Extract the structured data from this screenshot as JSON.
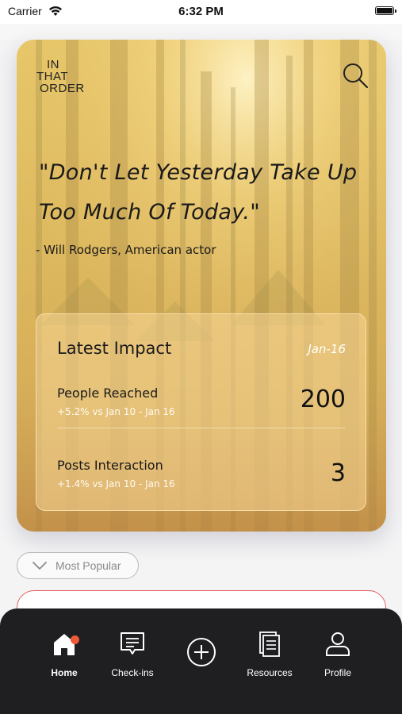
{
  "status_bar": {
    "carrier": "Carrier",
    "time": "6:32 PM"
  },
  "hero": {
    "logo": {
      "line1": "IN",
      "line2": "THAT",
      "line3": "ORDER"
    },
    "quote": "\"Don't Let Yesterday Take Up Too Much Of Today.\"",
    "author": "- Will Rodgers, American actor",
    "search_icon": "search-icon"
  },
  "impact": {
    "title": "Latest Impact",
    "date": "Jan-16",
    "metrics": [
      {
        "label": "People Reached",
        "change": "+5.2% vs Jan 10 - Jan 16",
        "value": "200"
      },
      {
        "label": "Posts Interaction",
        "change": "+1.4% vs Jan 10 - Jan 16",
        "value": "3"
      }
    ]
  },
  "filter": {
    "label": "Most Popular",
    "icon": "chevron-down-icon"
  },
  "tabs": [
    {
      "label": "Home",
      "icon": "home-icon",
      "active": true,
      "badge": true
    },
    {
      "label": "Check-ins",
      "icon": "chat-icon"
    },
    {
      "label": "",
      "icon": "add-circle-icon"
    },
    {
      "label": "Resources",
      "icon": "documents-icon"
    },
    {
      "label": "Profile",
      "icon": "user-icon"
    }
  ],
  "colors": {
    "accent": "#f05a36",
    "tab_bar": "#1f1e20",
    "card_border": "#e06060"
  }
}
